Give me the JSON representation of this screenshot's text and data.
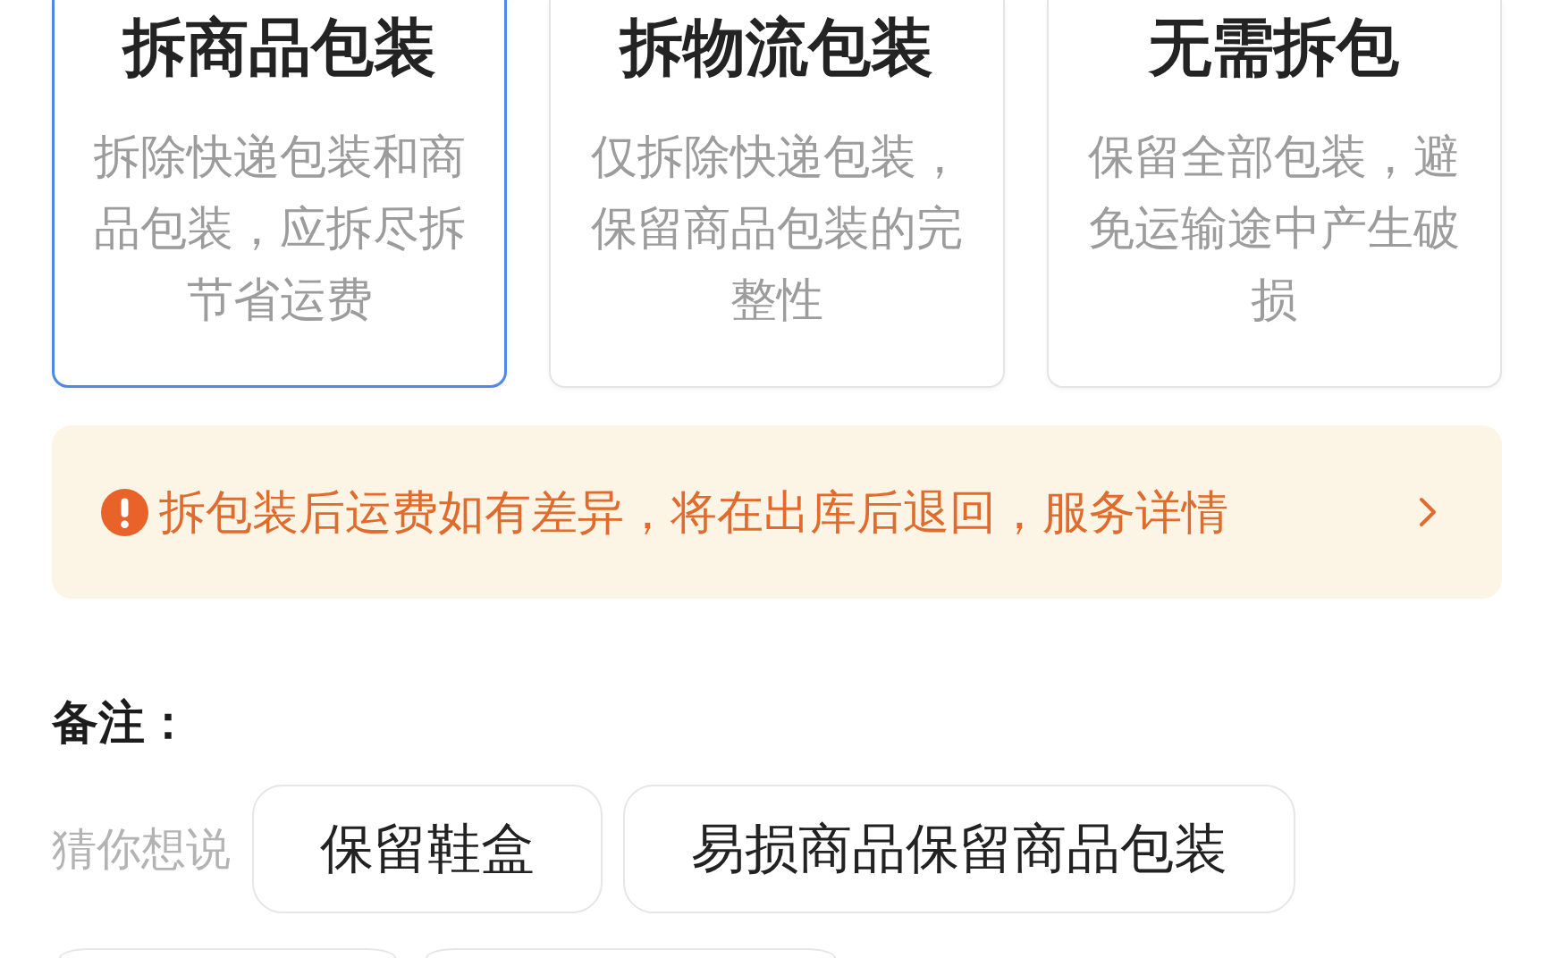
{
  "options": [
    {
      "title": "拆商品包装",
      "description": "拆除快递包装和商品包装，应拆尽拆节省运费",
      "selected": true
    },
    {
      "title": "拆物流包装",
      "description": "仅拆除快递包装，保留商品包装的完整性",
      "selected": false
    },
    {
      "title": "无需拆包",
      "description": "保留全部包装，避免运输途中产生破损",
      "selected": false
    }
  ],
  "notice": {
    "text": "拆包装后运费如有差异，将在出库后退回，服务详情"
  },
  "remarks": {
    "label": "备注：",
    "suggestions_label": "猜你想说",
    "suggestions": [
      {
        "kind": "chip",
        "label": "保留鞋盒"
      },
      {
        "kind": "chip",
        "label": "易损商品保留商品包装"
      },
      {
        "kind": "clipped"
      },
      {
        "kind": "clipped"
      }
    ]
  }
}
